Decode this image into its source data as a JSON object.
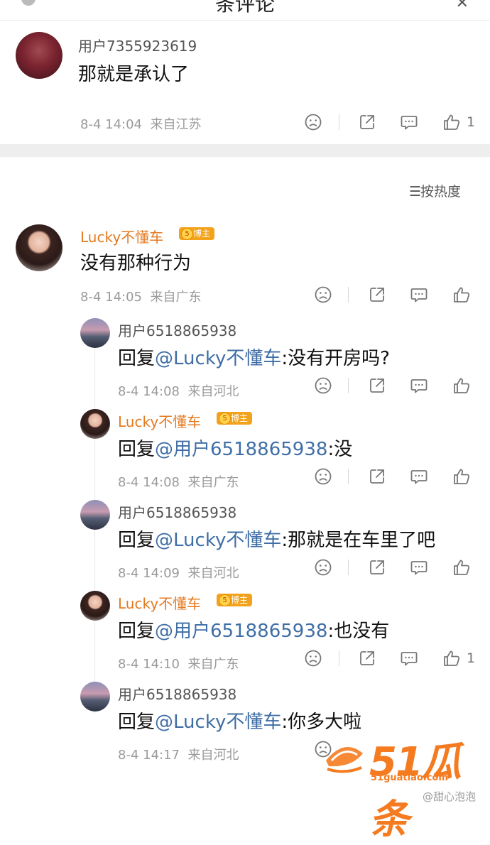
{
  "header": {
    "title": "条评论"
  },
  "top_comment": {
    "user": "用户7355923619",
    "text": "那就是承认了",
    "time": "8-4 14:04",
    "location": "来自江苏",
    "likes": "1"
  },
  "sort_label": "按热度",
  "main_comment": {
    "user": "Lucky不懂车",
    "badge": "博主",
    "text": "没有那种行为",
    "time": "8-4 14:05",
    "location": "来自广东"
  },
  "replies": [
    {
      "user": "用户6518865938",
      "prefix": "回复",
      "mention": "@Lucky不懂车",
      "text": ":没有开房吗?",
      "time": "8-4 14:08",
      "location": "来自河北",
      "likes": ""
    },
    {
      "user": "Lucky不懂车",
      "badge": "博主",
      "prefix": "回复",
      "mention": "@用户6518865938",
      "text": ":没",
      "time": "8-4 14:08",
      "location": "来自广东",
      "likes": ""
    },
    {
      "user": "用户6518865938",
      "prefix": "回复",
      "mention": "@Lucky不懂车",
      "text": ":那就是在车里了吧",
      "time": "8-4 14:09",
      "location": "来自河北",
      "likes": ""
    },
    {
      "user": "Lucky不懂车",
      "badge": "博主",
      "prefix": "回复",
      "mention": "@用户6518865938",
      "text": ":也没有",
      "time": "8-4 14:10",
      "location": "来自广东",
      "likes": "1"
    },
    {
      "user": "用户6518865938",
      "prefix": "回复",
      "mention": "@Lucky不懂车",
      "text": ":你多大啦",
      "time": "8-4 14:17",
      "location": "来自河北",
      "likes": ""
    }
  ],
  "watermark": {
    "brand": "51瓜条",
    "site": "51guatiao.com",
    "credit": "@甜心泡泡"
  },
  "colors": {
    "blogger_name": "#e47a20",
    "mention": "#3f6ea6",
    "badge": "#f2a21b"
  }
}
